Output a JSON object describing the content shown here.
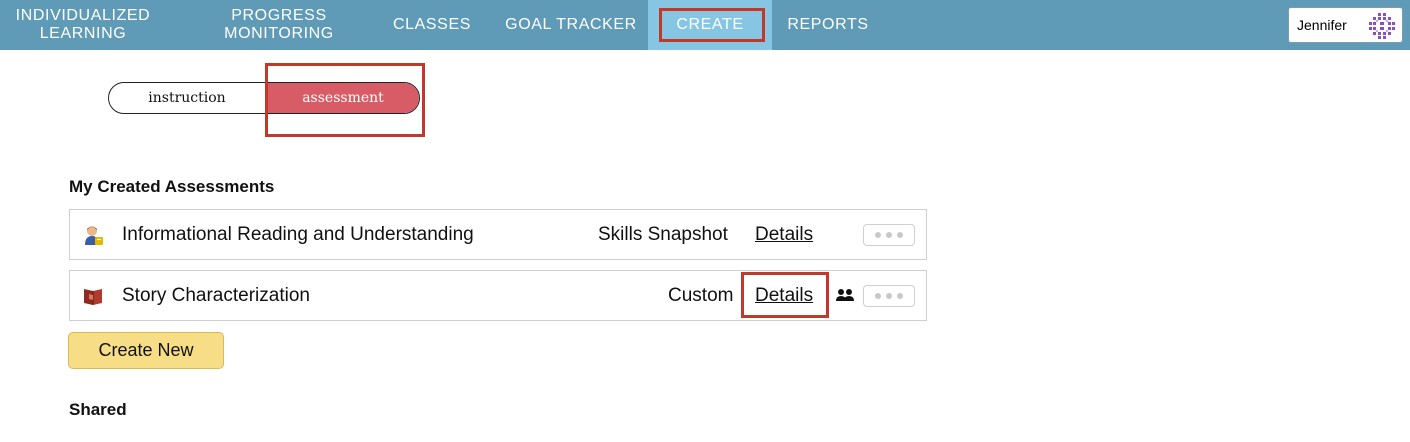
{
  "nav": {
    "items": [
      {
        "label_line1": "INDIVIDUALIZED",
        "label_line2": "LEARNING"
      },
      {
        "label_line1": "PROGRESS",
        "label_line2": "MONITORING"
      },
      {
        "label": "CLASSES"
      },
      {
        "label": "GOAL TRACKER"
      },
      {
        "label": "CREATE",
        "active": true
      },
      {
        "label": "REPORTS"
      }
    ],
    "user_name": "Jennifer",
    "bar_color": "#5f9ab7",
    "active_color": "#86c6e3"
  },
  "toggle": {
    "options": [
      "instruction",
      "assessment"
    ],
    "selected": "assessment",
    "selected_color": "#d85c66"
  },
  "my_created": {
    "title": "My Created Assessments",
    "rows": [
      {
        "icon": "reading-student-icon",
        "title": "Informational Reading and Understanding",
        "type": "Skills Snapshot",
        "details": "Details",
        "shared": false
      },
      {
        "icon": "book-icon",
        "title": "Story Characterization",
        "type": "Custom",
        "details": "Details",
        "shared": true
      }
    ],
    "create_label": "Create New"
  },
  "shared": {
    "title": "Shared"
  },
  "highlight_color": "#c0392b"
}
